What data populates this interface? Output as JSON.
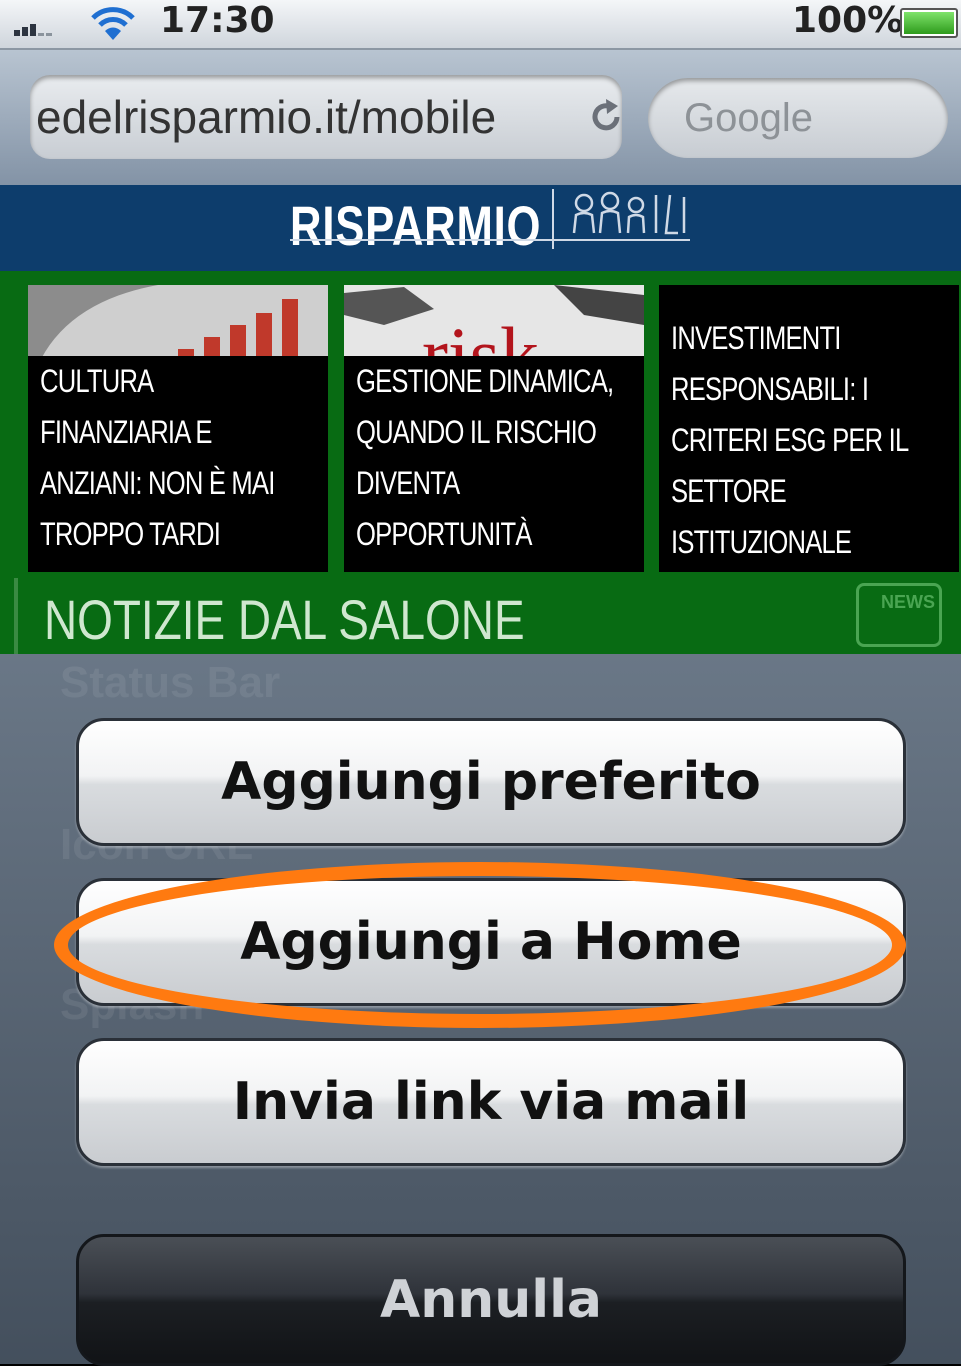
{
  "status_bar": {
    "time": "17:30",
    "battery_percent": "100%",
    "battery_level": 1.0,
    "signal_icon": "signal-bars-icon",
    "wifi_icon": "wifi-icon"
  },
  "browser": {
    "url": "edelrisparmio.it/mobile",
    "search_placeholder": "Google",
    "reload_icon": "reload-icon"
  },
  "site": {
    "logo_text": "RISPARMIO",
    "cards": [
      {
        "title_lines": [
          "CULTURA",
          "FINANZIARIA E",
          "ANZIANI: NON È MAI",
          "TROPPO TARDI"
        ]
      },
      {
        "title_lines": [
          "GESTIONE DINAMICA,",
          "QUANDO IL RISCHIO",
          "DIVENTA",
          "OPPORTUNITÀ"
        ],
        "image_word": "risk"
      },
      {
        "title_lines": [
          "INVESTIMENTI",
          "RESPONSABILI: I",
          "CRITERI ESG PER IL",
          "SETTORE",
          "ISTITUZIONALE"
        ]
      }
    ],
    "section_heading": "NOTIZIE DAL SALONE",
    "news_icon_label": "NEWS"
  },
  "action_sheet": {
    "buttons": [
      "Aggiungi preferito",
      "Aggiungi a Home",
      "Invia link via mail"
    ],
    "cancel": "Annulla",
    "background_text": [
      "Status Bar",
      "Icon URL",
      "Splash"
    ]
  },
  "colors": {
    "header_blue": "#0d3d6c",
    "band_green": "#086b13",
    "highlight_orange": "#ff7a10"
  }
}
